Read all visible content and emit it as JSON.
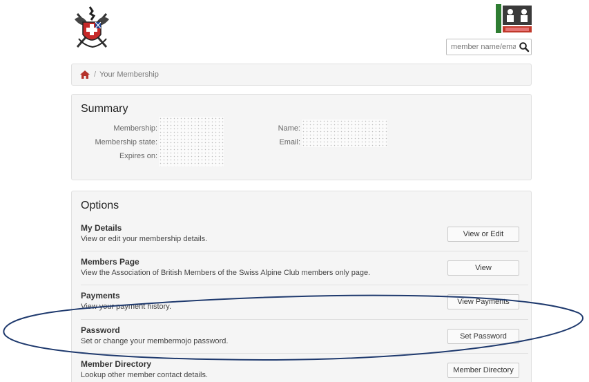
{
  "header": {
    "logo_left_icon": "swiss-alpine-club-crest-icon",
    "logo_right_icon": "membermojo-logo-icon",
    "search_placeholder": "member name/email",
    "search_icon": "search-icon"
  },
  "breadcrumb": {
    "home_icon": "home-icon",
    "separator": "/",
    "current": "Your Membership"
  },
  "summary": {
    "title": "Summary",
    "fields_left": [
      {
        "label": "Membership:"
      },
      {
        "label": "Membership state:"
      },
      {
        "label": "Expires on:"
      }
    ],
    "fields_right": [
      {
        "label": "Name:"
      },
      {
        "label": "Email:"
      }
    ]
  },
  "options": {
    "title": "Options",
    "items": [
      {
        "title": "My Details",
        "description": "View or edit your membership details.",
        "button": "View or Edit"
      },
      {
        "title": "Members Page",
        "description": "View the Association of British Members of the Swiss Alpine Club members only page.",
        "button": "View"
      },
      {
        "title": "Payments",
        "description": "View your payment history.",
        "button": "View Payments"
      },
      {
        "title": "Password",
        "description": "Set or change your membermojo password.",
        "button": "Set Password"
      },
      {
        "title": "Member Directory",
        "description": "Lookup other member contact details.",
        "button": "Member Directory"
      }
    ]
  },
  "colors": {
    "panel_bg": "#f5f5f5",
    "home_icon": "#b5322a",
    "highlight_ellipse": "#1f3a6e",
    "mojo_red": "#c0392b"
  }
}
